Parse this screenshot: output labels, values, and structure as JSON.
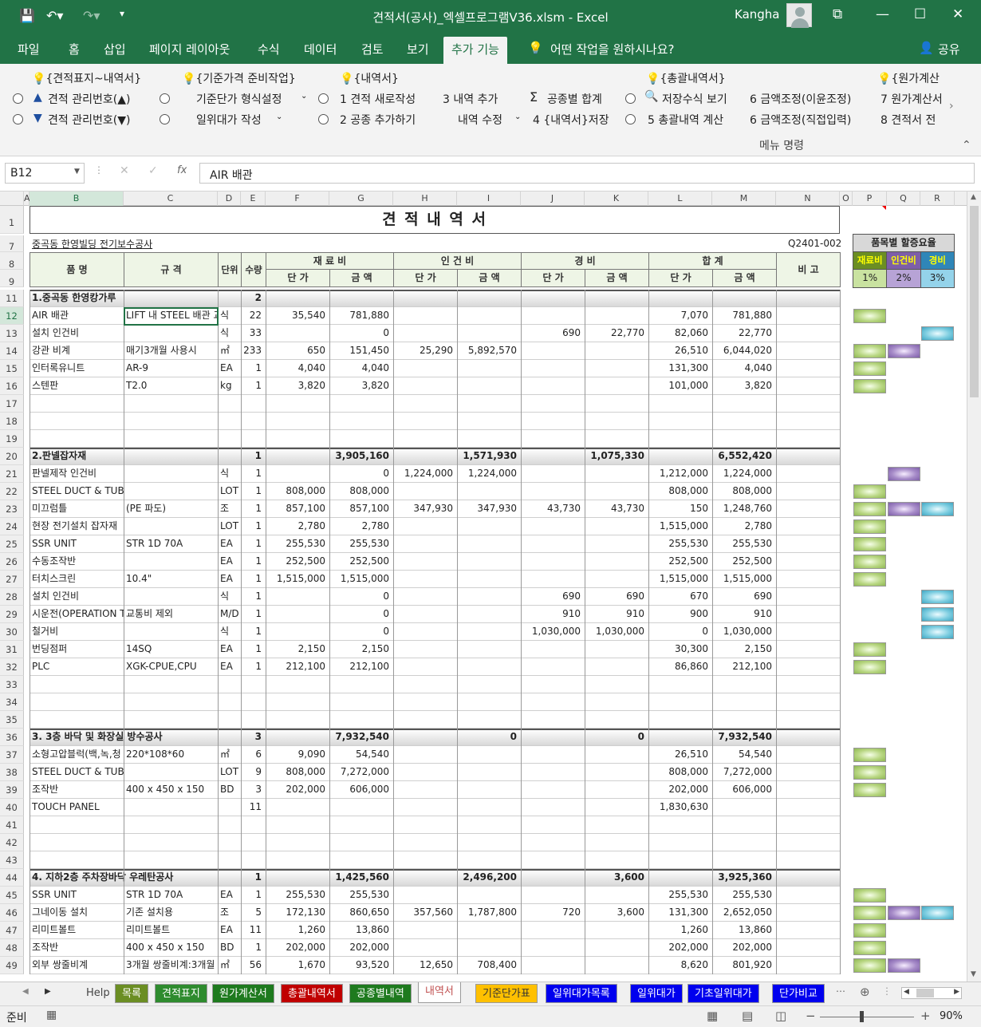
{
  "window": {
    "title": "견적서(공사)_엑셀프로그램V36.xlsm  -  Excel",
    "user": "Kangha"
  },
  "tabs": [
    "파일",
    "홈",
    "삽입",
    "페이지 레이아웃",
    "수식",
    "데이터",
    "검토",
    "보기",
    "추가 기능"
  ],
  "active_tab": "추가 기능",
  "tell_me": "어떤 작업을 원하시나요?",
  "share": "공유",
  "ribbon": {
    "row1": [
      "{견적표지~내역서}",
      "{기준가격 준비작업}",
      "{내역서}",
      "{총괄내역서}",
      "{원가계산"
    ],
    "row2": [
      "견적 관리번호(▲)",
      "기준단가 형식설정",
      "1  견적 새로작성",
      "3  내역 추가",
      "공종별 합계",
      "저장수식 보기",
      "6  금액조정(이윤조정)",
      "7  원가계산서"
    ],
    "row3": [
      "견적 관리번호(▼)",
      "일위대가 작성",
      "2  공종 추가하기",
      "내역 수정",
      "4  {내역서}저장",
      "5  총괄내역 계산",
      "6  금액조정(직접입력)",
      "8  견적서 전"
    ],
    "group": "메뉴 명령"
  },
  "formula_bar": {
    "name_box": "B12",
    "formula": "AIR 배관"
  },
  "columns": [
    "A",
    "B",
    "C",
    "D",
    "E",
    "F",
    "G",
    "H",
    "I",
    "J",
    "K",
    "L",
    "M",
    "N",
    "O",
    "P",
    "Q",
    "R"
  ],
  "sheet": {
    "title": "견 적 내 역 서",
    "project": "중곡동 한영빌딩 전기보수공사",
    "doc_no": "Q2401-002",
    "headers": {
      "item": "품 명",
      "spec": "규 격",
      "unit": "단위",
      "qty": "수량",
      "material": "재 료 비",
      "labor": "인 건 비",
      "expense": "경   비",
      "total": "합   계",
      "note": "비 고",
      "unit_price": "단 가",
      "amount": "금 액"
    },
    "markup": {
      "title": "품목별 할증요율",
      "material_label": "재료비",
      "labor_label": "인건비",
      "expense_label": "경비",
      "material": "1%",
      "labor": "2%",
      "expense": "3%"
    },
    "rows": [
      {
        "r": "11",
        "sec": true,
        "b": "1.중곡동 한영캉가루",
        "e": "2"
      },
      {
        "r": "12",
        "b": "AIR 배관",
        "c": "LIFT 내 STEEL 배관 교",
        "d": "식",
        "e": "22",
        "f": "35,540",
        "g": "781,880",
        "l": "7,070",
        "m": "781,880",
        "sw": [
          "g"
        ]
      },
      {
        "r": "13",
        "b": "설치 인건비",
        "d": "식",
        "e": "33",
        "g": "0",
        "j": "690",
        "k": "22,770",
        "l": "82,060",
        "m": "22,770",
        "sw": [
          "",
          "",
          "b"
        ]
      },
      {
        "r": "14",
        "b": "강관 비계",
        "c": " 매기3개월 사용시",
        "d": "㎡",
        "e": "233",
        "f": "650",
        "g": "151,450",
        "h": "25,290",
        "i": "5,892,570",
        "l": "26,510",
        "m": "6,044,020",
        "sw": [
          "g",
          "p"
        ]
      },
      {
        "r": "15",
        "b": "인터록유니트",
        "c": "AR-9",
        "d": "EA",
        "e": "1",
        "f": "4,040",
        "g": "4,040",
        "l": "131,300",
        "m": "4,040",
        "sw": [
          "g"
        ]
      },
      {
        "r": "16",
        "b": "스텐판",
        "c": "T2.0",
        "d": "kg",
        "e": "1",
        "f": "3,820",
        "g": "3,820",
        "l": "101,000",
        "m": "3,820",
        "sw": [
          "g"
        ]
      },
      {
        "r": "17"
      },
      {
        "r": "18"
      },
      {
        "r": "19"
      },
      {
        "r": "20",
        "sec": true,
        "b": "2.판넬잡자재",
        "e": "1",
        "g": "3,905,160",
        "i": "1,571,930",
        "k": "1,075,330",
        "m": "6,552,420"
      },
      {
        "r": "21",
        "b": "판넬제작 인건비",
        "d": "식",
        "e": "1",
        "g": "0",
        "h": "1,224,000",
        "i": "1,224,000",
        "l": "1,212,000",
        "m": "1,224,000",
        "sw": [
          "",
          "p"
        ]
      },
      {
        "r": "22",
        "b": "STEEL DUCT & TUBE",
        "d": "LOT",
        "e": "1",
        "f": "808,000",
        "g": "808,000",
        "l": "808,000",
        "m": "808,000",
        "sw": [
          "g"
        ]
      },
      {
        "r": "23",
        "b": "미끄럼틀",
        "c": "(PE 파도)",
        "d": "조",
        "e": "1",
        "f": "857,100",
        "g": "857,100",
        "h": "347,930",
        "i": "347,930",
        "j": "43,730",
        "k": "43,730",
        "l": "150",
        "m": "1,248,760",
        "sw": [
          "g",
          "p",
          "b"
        ]
      },
      {
        "r": "24",
        "b": "현장 전기설치 잡자재",
        "d": "LOT",
        "e": "1",
        "f": "2,780",
        "g": "2,780",
        "l": "1,515,000",
        "m": "2,780",
        "sw": [
          "g"
        ]
      },
      {
        "r": "25",
        "b": "SSR UNIT",
        "c": "STR 1D 70A",
        "d": "EA",
        "e": "1",
        "f": "255,530",
        "g": "255,530",
        "l": "255,530",
        "m": "255,530",
        "sw": [
          "g"
        ]
      },
      {
        "r": "26",
        "b": "수동조작반",
        "d": "EA",
        "e": "1",
        "f": "252,500",
        "g": "252,500",
        "l": "252,500",
        "m": "252,500",
        "sw": [
          "g"
        ]
      },
      {
        "r": "27",
        "b": "터치스크린",
        "c": "10.4\"",
        "d": "EA",
        "e": "1",
        "f": "1,515,000",
        "g": "1,515,000",
        "l": "1,515,000",
        "m": "1,515,000",
        "sw": [
          "g"
        ]
      },
      {
        "r": "28",
        "b": "설치 인건비",
        "d": "식",
        "e": "1",
        "g": "0",
        "j": "690",
        "k": "690",
        "l": "670",
        "m": "690",
        "sw": [
          "",
          "",
          "b"
        ]
      },
      {
        "r": "29",
        "b": "시운전(OPERATION T",
        "c": "교통비 제외",
        "d": "M/D",
        "e": "1",
        "g": "0",
        "j": "910",
        "k": "910",
        "l": "900",
        "m": "910",
        "sw": [
          "",
          "",
          "b"
        ]
      },
      {
        "r": "30",
        "b": "철거비",
        "d": "식",
        "e": "1",
        "g": "0",
        "j": "1,030,000",
        "k": "1,030,000",
        "l": "0",
        "m": "1,030,000",
        "sw": [
          "",
          "",
          "b"
        ]
      },
      {
        "r": "31",
        "b": "번딩점퍼",
        "c": "14SQ",
        "d": "EA",
        "e": "1",
        "f": "2,150",
        "g": "2,150",
        "l": "30,300",
        "m": "2,150",
        "sw": [
          "g"
        ]
      },
      {
        "r": "32",
        "b": "PLC",
        "c": "XGK-CPUE,CPU",
        "d": "EA",
        "e": "1",
        "f": "212,100",
        "g": "212,100",
        "l": "86,860",
        "m": "212,100",
        "sw": [
          "g"
        ]
      },
      {
        "r": "33"
      },
      {
        "r": "34"
      },
      {
        "r": "35"
      },
      {
        "r": "36",
        "sec": true,
        "b": "3. 3층 바닥 및 화장실 방수공사",
        "e": "3",
        "g": "7,932,540",
        "i": "0",
        "k": "0",
        "m": "7,932,540"
      },
      {
        "r": "37",
        "b": "소형고압블럭(백,녹,청",
        "c": "220*108*60",
        "d": "㎡",
        "e": "6",
        "f": "9,090",
        "g": "54,540",
        "l": "26,510",
        "m": "54,540",
        "sw": [
          "g"
        ]
      },
      {
        "r": "38",
        "b": "STEEL DUCT & TUBE",
        "d": "LOT",
        "e": "9",
        "f": "808,000",
        "g": "7,272,000",
        "l": "808,000",
        "m": "7,272,000",
        "sw": [
          "g"
        ]
      },
      {
        "r": "39",
        "b": "조작반",
        "c": "400 x 450 x 150",
        "d": "BD",
        "e": "3",
        "f": "202,000",
        "g": "606,000",
        "l": "202,000",
        "m": "606,000",
        "sw": [
          "g"
        ]
      },
      {
        "r": "40",
        "b": "TOUCH PANEL",
        "e": "11",
        "l": "1,830,630"
      },
      {
        "r": "41"
      },
      {
        "r": "42"
      },
      {
        "r": "43"
      },
      {
        "r": "44",
        "sec": true,
        "b": "4. 지하2층 주차장바닥 우레탄공사",
        "e": "1",
        "g": "1,425,560",
        "i": "2,496,200",
        "k": "3,600",
        "m": "3,925,360"
      },
      {
        "r": "45",
        "b": "SSR UNIT",
        "c": "STR 1D 70A",
        "d": "EA",
        "e": "1",
        "f": "255,530",
        "g": "255,530",
        "l": "255,530",
        "m": "255,530",
        "sw": [
          "g"
        ]
      },
      {
        "r": "46",
        "b": "그네이동 설치",
        "c": "기존 설치용",
        "d": "조",
        "e": "5",
        "f": "172,130",
        "g": "860,650",
        "h": "357,560",
        "i": "1,787,800",
        "j": "720",
        "k": "3,600",
        "l": "131,300",
        "m": "2,652,050",
        "sw": [
          "g",
          "p",
          "b"
        ]
      },
      {
        "r": "47",
        "b": "리미트볼트",
        "c": "리미트볼트",
        "d": "EA",
        "e": "11",
        "f": "1,260",
        "g": "13,860",
        "l": "1,260",
        "m": "13,860",
        "sw": [
          "g"
        ]
      },
      {
        "r": "48",
        "b": "조작반",
        "c": "400 x 450 x 150",
        "d": "BD",
        "e": "1",
        "f": "202,000",
        "g": "202,000",
        "l": "202,000",
        "m": "202,000",
        "sw": [
          "g"
        ]
      },
      {
        "r": "49",
        "b": "외부 쌍줄비계",
        "c": "3개월 쌍줄비계:3개월",
        "d": "㎡",
        "e": "56",
        "f": "1,670",
        "g": "93,520",
        "h": "12,650",
        "i": "708,400",
        "l": "8,620",
        "m": "801,920",
        "sw": [
          "g",
          "p"
        ]
      }
    ]
  },
  "sheet_tabs": [
    {
      "label": "Help",
      "bg": "#f0f0f0",
      "fg": "#444"
    },
    {
      "label": "목록",
      "bg": "#6b8e23",
      "fg": "#fff"
    },
    {
      "label": "견적표지",
      "bg": "#2e8b2e",
      "fg": "#fff"
    },
    {
      "label": "원가계산서",
      "bg": "#1e7a1e",
      "fg": "#fff"
    },
    {
      "label": "총괄내역서",
      "bg": "#c00000",
      "fg": "#fff"
    },
    {
      "label": "공종별내역",
      "bg": "#1e7a1e",
      "fg": "#fff"
    },
    {
      "label": "내역서",
      "bg": "#ffffff",
      "fg": "#c05050"
    },
    {
      "label": "기준단가표",
      "bg": "#ffc000",
      "fg": "#333"
    },
    {
      "label": "일위대가목록",
      "bg": "#0000ee",
      "fg": "#fff"
    },
    {
      "label": "일위대가",
      "bg": "#0000ee",
      "fg": "#fff"
    },
    {
      "label": "기초일위대가",
      "bg": "#0000ee",
      "fg": "#fff"
    },
    {
      "label": "단가비교",
      "bg": "#0000ee",
      "fg": "#fff"
    }
  ],
  "status": {
    "ready": "준비",
    "zoom": "90%"
  },
  "colors": {
    "excel_green": "#217346"
  }
}
